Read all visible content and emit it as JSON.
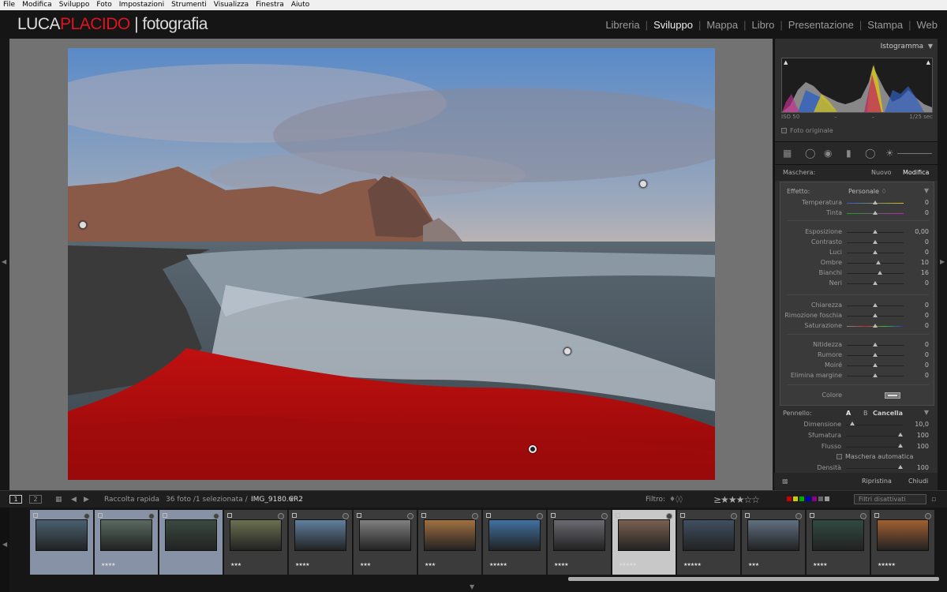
{
  "menu": [
    "File",
    "Modifica",
    "Sviluppo",
    "Foto",
    "Impostazioni",
    "Strumenti",
    "Visualizza",
    "Finestra",
    "Aiuto"
  ],
  "logo": {
    "part1": "LUCA",
    "part2": "PLACIDO",
    "part3": "| fotografia"
  },
  "modules": [
    "Libreria",
    "Sviluppo",
    "Mappa",
    "Libro",
    "Presentazione",
    "Stampa",
    "Web"
  ],
  "panel": {
    "histogram_title": "Istogramma",
    "iso": "ISO 50",
    "dash1": "–",
    "dash2": "–",
    "shutter": "1/25 sec",
    "original_photo": "Foto originale",
    "mask_label": "Maschera:",
    "mask_new": "Nuovo",
    "mask_edit": "Modifica",
    "effect_label": "Effetto:",
    "effect_value": "Personale ♢"
  },
  "sliders": [
    {
      "label": "Temperatura",
      "value": "0",
      "pos": 0.5
    },
    {
      "label": "Tinta",
      "value": "0",
      "pos": 0.5
    },
    {
      "label": "Esposizione",
      "value": "0,00",
      "pos": 0.5
    },
    {
      "label": "Contrasto",
      "value": "0",
      "pos": 0.5
    },
    {
      "label": "Luci",
      "value": "0",
      "pos": 0.5
    },
    {
      "label": "Ombre",
      "value": "10",
      "pos": 0.55
    },
    {
      "label": "Bianchi",
      "value": "16",
      "pos": 0.58
    },
    {
      "label": "Neri",
      "value": "0",
      "pos": 0.5
    },
    {
      "label": "Chiarezza",
      "value": "0",
      "pos": 0.5
    },
    {
      "label": "Rimozione foschia",
      "value": "0",
      "pos": 0.5
    },
    {
      "label": "Saturazione",
      "value": "0",
      "pos": 0.5
    },
    {
      "label": "Nitidezza",
      "value": "0",
      "pos": 0.5
    },
    {
      "label": "Rumore",
      "value": "0",
      "pos": 0.5
    },
    {
      "label": "Moiré",
      "value": "0",
      "pos": 0.5
    },
    {
      "label": "Elimina margine",
      "value": "0",
      "pos": 0.5
    }
  ],
  "color_label": "Colore",
  "brush": {
    "label": "Pennello:",
    "a": "A",
    "b": "B",
    "erase": "Cancella",
    "size_label": "Dimensione",
    "size_value": "10,0",
    "feather_label": "Sfumatura",
    "feather_value": "100",
    "flow_label": "Flusso",
    "flow_value": "100",
    "automask": "Maschera automatica",
    "density_label": "Densità",
    "density_value": "100"
  },
  "bottom": {
    "reset": "Ripristina",
    "close": "Chiudi"
  },
  "toolbar": {
    "view1": "1",
    "view2": "2",
    "collection": "Raccolta rapida",
    "count": "36 foto /1 selezionata /",
    "filename": "IMG_9180.CR2",
    "filter_label": "Filtro:",
    "filter_value": "Filtri disattivati"
  },
  "thumbs": [
    {
      "stars": "",
      "state": "sel",
      "color": "#4a6070"
    },
    {
      "stars": "★★★★",
      "state": "sel",
      "color": "#5a6a60"
    },
    {
      "stars": "",
      "state": "sel",
      "color": "#3a4a40"
    },
    {
      "stars": "★★★",
      "state": "",
      "color": "#6a7050"
    },
    {
      "stars": "★★★★",
      "state": "",
      "color": "#6080a0"
    },
    {
      "stars": "★★★",
      "state": "",
      "color": "#808080"
    },
    {
      "stars": "★★★",
      "state": "",
      "color": "#a07040"
    },
    {
      "stars": "★★★★★",
      "state": "",
      "color": "#4070a0"
    },
    {
      "stars": "★★★★",
      "state": "",
      "color": "#6a6a70"
    },
    {
      "stars": "★★★★★",
      "state": "cur",
      "color": "#7a6050"
    },
    {
      "stars": "★★★★★",
      "state": "",
      "color": "#405060"
    },
    {
      "stars": "★★★",
      "state": "",
      "color": "#607080"
    },
    {
      "stars": "★★★★",
      "state": "",
      "color": "#304a40"
    },
    {
      "stars": "★★★★★",
      "state": "",
      "color": "#a06030"
    }
  ]
}
